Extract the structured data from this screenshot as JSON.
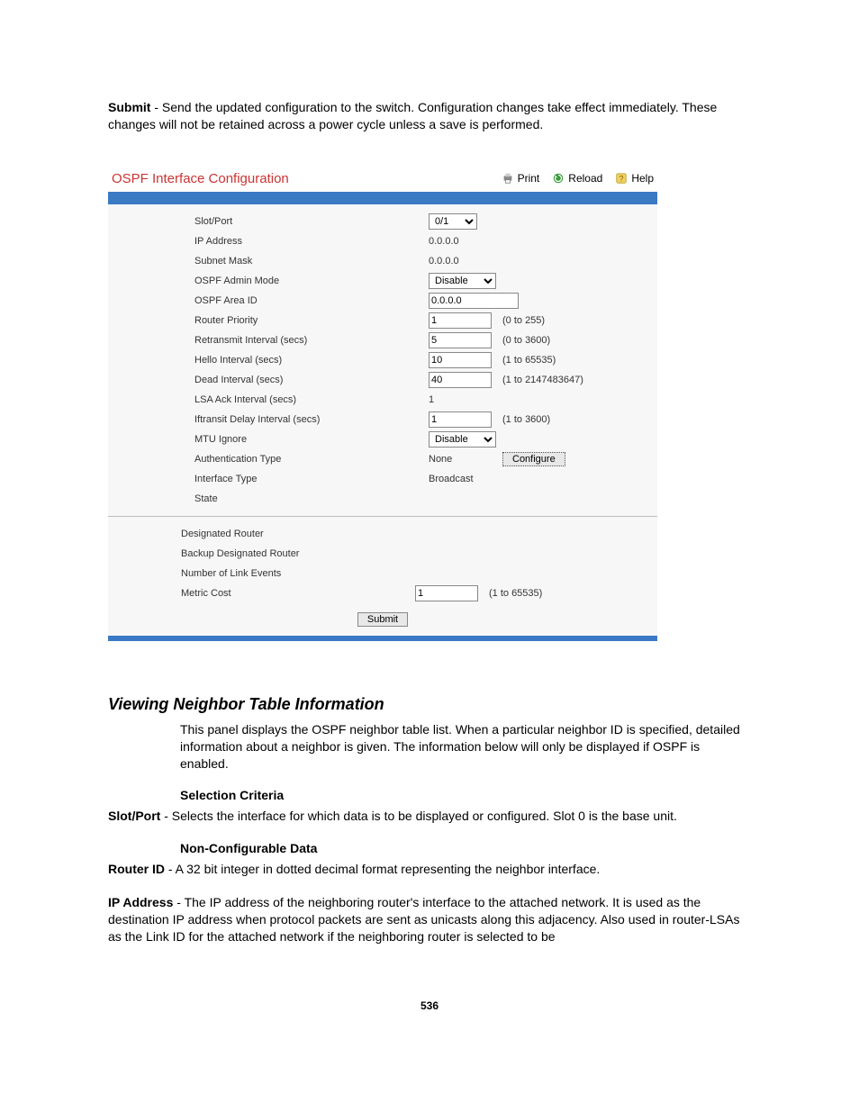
{
  "intro": {
    "submit_label": "Submit",
    "submit_desc": " - Send the updated configuration to the switch. Configuration changes take effect immediately. These changes will not be retained across a power cycle unless a save is performed."
  },
  "panel": {
    "title": "OSPF Interface Configuration",
    "actions": {
      "print": "Print",
      "reload": "Reload",
      "help": "Help"
    },
    "rows": {
      "slot_port": {
        "label": "Slot/Port",
        "value": "0/1"
      },
      "ip_address": {
        "label": "IP Address",
        "value": "0.0.0.0"
      },
      "subnet_mask": {
        "label": "Subnet Mask",
        "value": "0.0.0.0"
      },
      "admin_mode": {
        "label": "OSPF Admin Mode",
        "value": "Disable"
      },
      "area_id": {
        "label": "OSPF Area ID",
        "value": "0.0.0.0"
      },
      "router_priority": {
        "label": "Router Priority",
        "value": "1",
        "hint": "(0 to 255)"
      },
      "retransmit": {
        "label": "Retransmit Interval (secs)",
        "value": "5",
        "hint": "(0 to 3600)"
      },
      "hello": {
        "label": "Hello Interval (secs)",
        "value": "10",
        "hint": "(1 to 65535)"
      },
      "dead": {
        "label": "Dead Interval (secs)",
        "value": "40",
        "hint": "(1 to 2147483647)"
      },
      "lsa_ack": {
        "label": "LSA Ack Interval (secs)",
        "value": "1"
      },
      "iftransit": {
        "label": "Iftransit Delay Interval (secs)",
        "value": "1",
        "hint": "(1 to 3600)"
      },
      "mtu_ignore": {
        "label": "MTU Ignore",
        "value": "Disable"
      },
      "auth_type": {
        "label": "Authentication Type",
        "value": "None",
        "button": "Configure"
      },
      "iface_type": {
        "label": "Interface Type",
        "value": "Broadcast"
      },
      "state": {
        "label": "State"
      },
      "designated": {
        "label": "Designated Router"
      },
      "backup": {
        "label": "Backup Designated Router"
      },
      "linkevents": {
        "label": "Number of Link Events"
      },
      "metric": {
        "label": "Metric Cost",
        "value": "1",
        "hint": "(1 to 65535)"
      }
    },
    "submit": "Submit"
  },
  "section": {
    "title": "Viewing Neighbor Table Information",
    "intro": "This panel displays the OSPF neighbor table list. When a particular neighbor ID is specified, detailed information about a neighbor is given. The information below will only be displayed if OSPF is enabled.",
    "sel_head": "Selection Criteria",
    "slotport_label": "Slot/Port",
    "slotport_desc": " - Selects the interface for which data is to be displayed or configured. Slot 0 is the base unit.",
    "nonconf_head": "Non-Configurable Data",
    "routerid_label": "Router ID",
    "routerid_desc": " - A 32 bit integer in dotted decimal format representing the neighbor interface.",
    "ipaddr_label": "IP Address",
    "ipaddr_desc": " - The IP address of the neighboring router's interface to the attached network. It is used as the destination IP address when protocol packets are sent as unicasts along this adjacency. Also used in router-LSAs as the Link ID for the attached network if the neighboring router is selected to be"
  },
  "page_number": "536"
}
